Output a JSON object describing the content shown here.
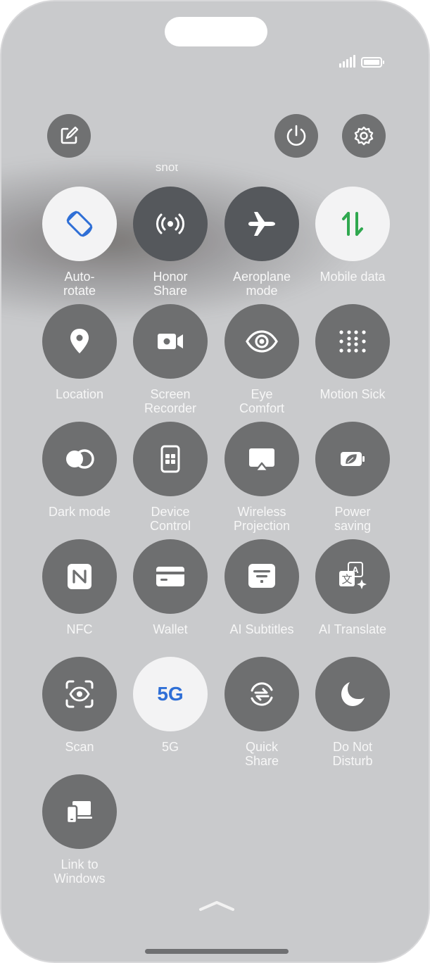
{
  "status_bar": {
    "signal_icon": "signal-icon",
    "battery_icon": "battery-icon"
  },
  "top_buttons": {
    "edit": "edit-icon",
    "power": "power-icon",
    "settings": "gear-icon"
  },
  "partial_label": "shot",
  "tiles": [
    {
      "label": "Auto-\nrotate",
      "state": "on",
      "icon": "auto-rotate-icon"
    },
    {
      "label": "Honor\nShare",
      "state": "off",
      "icon": "honor-share-icon"
    },
    {
      "label": "Aeroplane\nmode",
      "state": "off",
      "icon": "airplane-icon"
    },
    {
      "label": "Mobile data",
      "state": "on",
      "icon": "mobile-data-icon"
    },
    {
      "label": "Location",
      "state": "off",
      "icon": "location-icon"
    },
    {
      "label": "Screen\nRecorder",
      "state": "off",
      "icon": "screen-recorder-icon"
    },
    {
      "label": "Eye\nComfort",
      "state": "off",
      "icon": "eye-icon"
    },
    {
      "label": "Motion Sick",
      "state": "off",
      "icon": "motion-sick-icon"
    },
    {
      "label": "Dark mode",
      "state": "off",
      "icon": "dark-mode-icon"
    },
    {
      "label": "Device\nControl",
      "state": "off",
      "icon": "device-control-icon"
    },
    {
      "label": "Wireless\nProjection",
      "state": "off",
      "icon": "wireless-projection-icon"
    },
    {
      "label": "Power\nsaving",
      "state": "off",
      "icon": "power-saving-icon"
    },
    {
      "label": "NFC",
      "state": "off",
      "icon": "nfc-icon"
    },
    {
      "label": "Wallet",
      "state": "off",
      "icon": "wallet-icon"
    },
    {
      "label": "AI Subtitles",
      "state": "off",
      "icon": "ai-subtitles-icon"
    },
    {
      "label": "AI Translate",
      "state": "off",
      "icon": "ai-translate-icon"
    },
    {
      "label": "Scan",
      "state": "off",
      "icon": "scan-icon"
    },
    {
      "label": "5G",
      "state": "on",
      "icon": "5g-icon",
      "glyph": "5G"
    },
    {
      "label": "Quick\nShare",
      "state": "off",
      "icon": "quick-share-icon"
    },
    {
      "label": "Do Not\nDisturb",
      "state": "off",
      "icon": "moon-icon"
    },
    {
      "label": "Link to\nWindows",
      "state": "off",
      "icon": "link-to-windows-icon"
    }
  ],
  "colors": {
    "panel_bg": "#c9cacc",
    "tile_off": "#6e6f70",
    "tile_on": "#f3f3f4",
    "accent_blue": "#2f6fd6",
    "accent_green": "#2fa84f"
  }
}
